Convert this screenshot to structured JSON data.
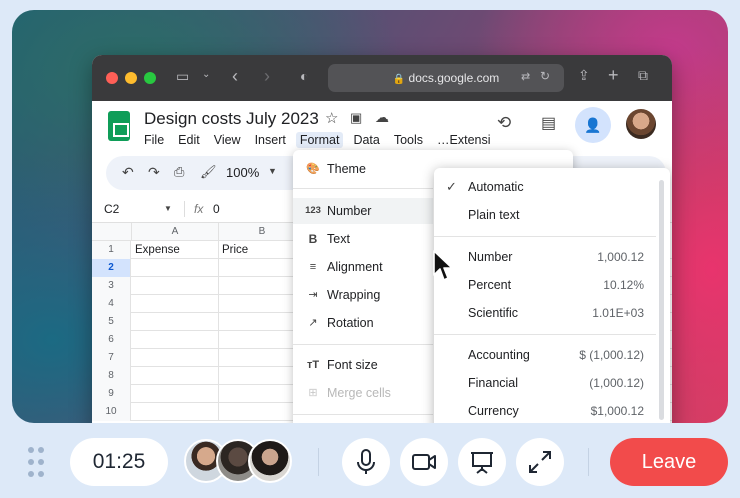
{
  "browser": {
    "url": "docs.google.com"
  },
  "doc": {
    "title": "Design costs July 2023",
    "menus": [
      "File",
      "Edit",
      "View",
      "Insert",
      "Format",
      "Data",
      "Tools",
      "…Extensi"
    ]
  },
  "toolbar": {
    "zoom": "100%"
  },
  "formula_bar": {
    "cell_ref": "C2",
    "fx": "fx",
    "value": "0"
  },
  "grid": {
    "columns": [
      "A",
      "B"
    ],
    "rows": [
      "1",
      "2",
      "3",
      "4",
      "5",
      "6",
      "7",
      "8",
      "9",
      "10"
    ],
    "header_row": [
      "Expense",
      "Price"
    ]
  },
  "format_menu": {
    "items": [
      {
        "icon": "palette-icon",
        "label": "Theme"
      },
      {
        "icon": "number-icon",
        "label": "Number"
      },
      {
        "icon": "bold-icon",
        "label": "Text"
      },
      {
        "icon": "align-icon",
        "label": "Alignment"
      },
      {
        "icon": "wrap-icon",
        "label": "Wrapping"
      },
      {
        "icon": "rotate-icon",
        "label": "Rotation"
      },
      {
        "icon": "font-size-icon",
        "label": "Font size"
      },
      {
        "icon": "merge-icon",
        "label": "Merge cells"
      }
    ],
    "number_icon_text": "123"
  },
  "number_menu": {
    "items": [
      {
        "label": "Automatic",
        "example": "",
        "checked": true
      },
      {
        "label": "Plain text",
        "example": ""
      },
      {
        "label": "Number",
        "example": "1,000.12"
      },
      {
        "label": "Percent",
        "example": "10.12%"
      },
      {
        "label": "Scientific",
        "example": "1.01E+03"
      },
      {
        "label": "Accounting",
        "example": "$ (1,000.12)"
      },
      {
        "label": "Financial",
        "example": "(1,000.12)"
      },
      {
        "label": "Currency",
        "example": "$1,000.12"
      }
    ]
  },
  "call": {
    "timer": "01:25",
    "leave_label": "Leave"
  },
  "colors": {
    "sheets_green": "#0f9d58",
    "leave_red": "#f24b4b",
    "accent_blue": "#d3e3fd"
  }
}
